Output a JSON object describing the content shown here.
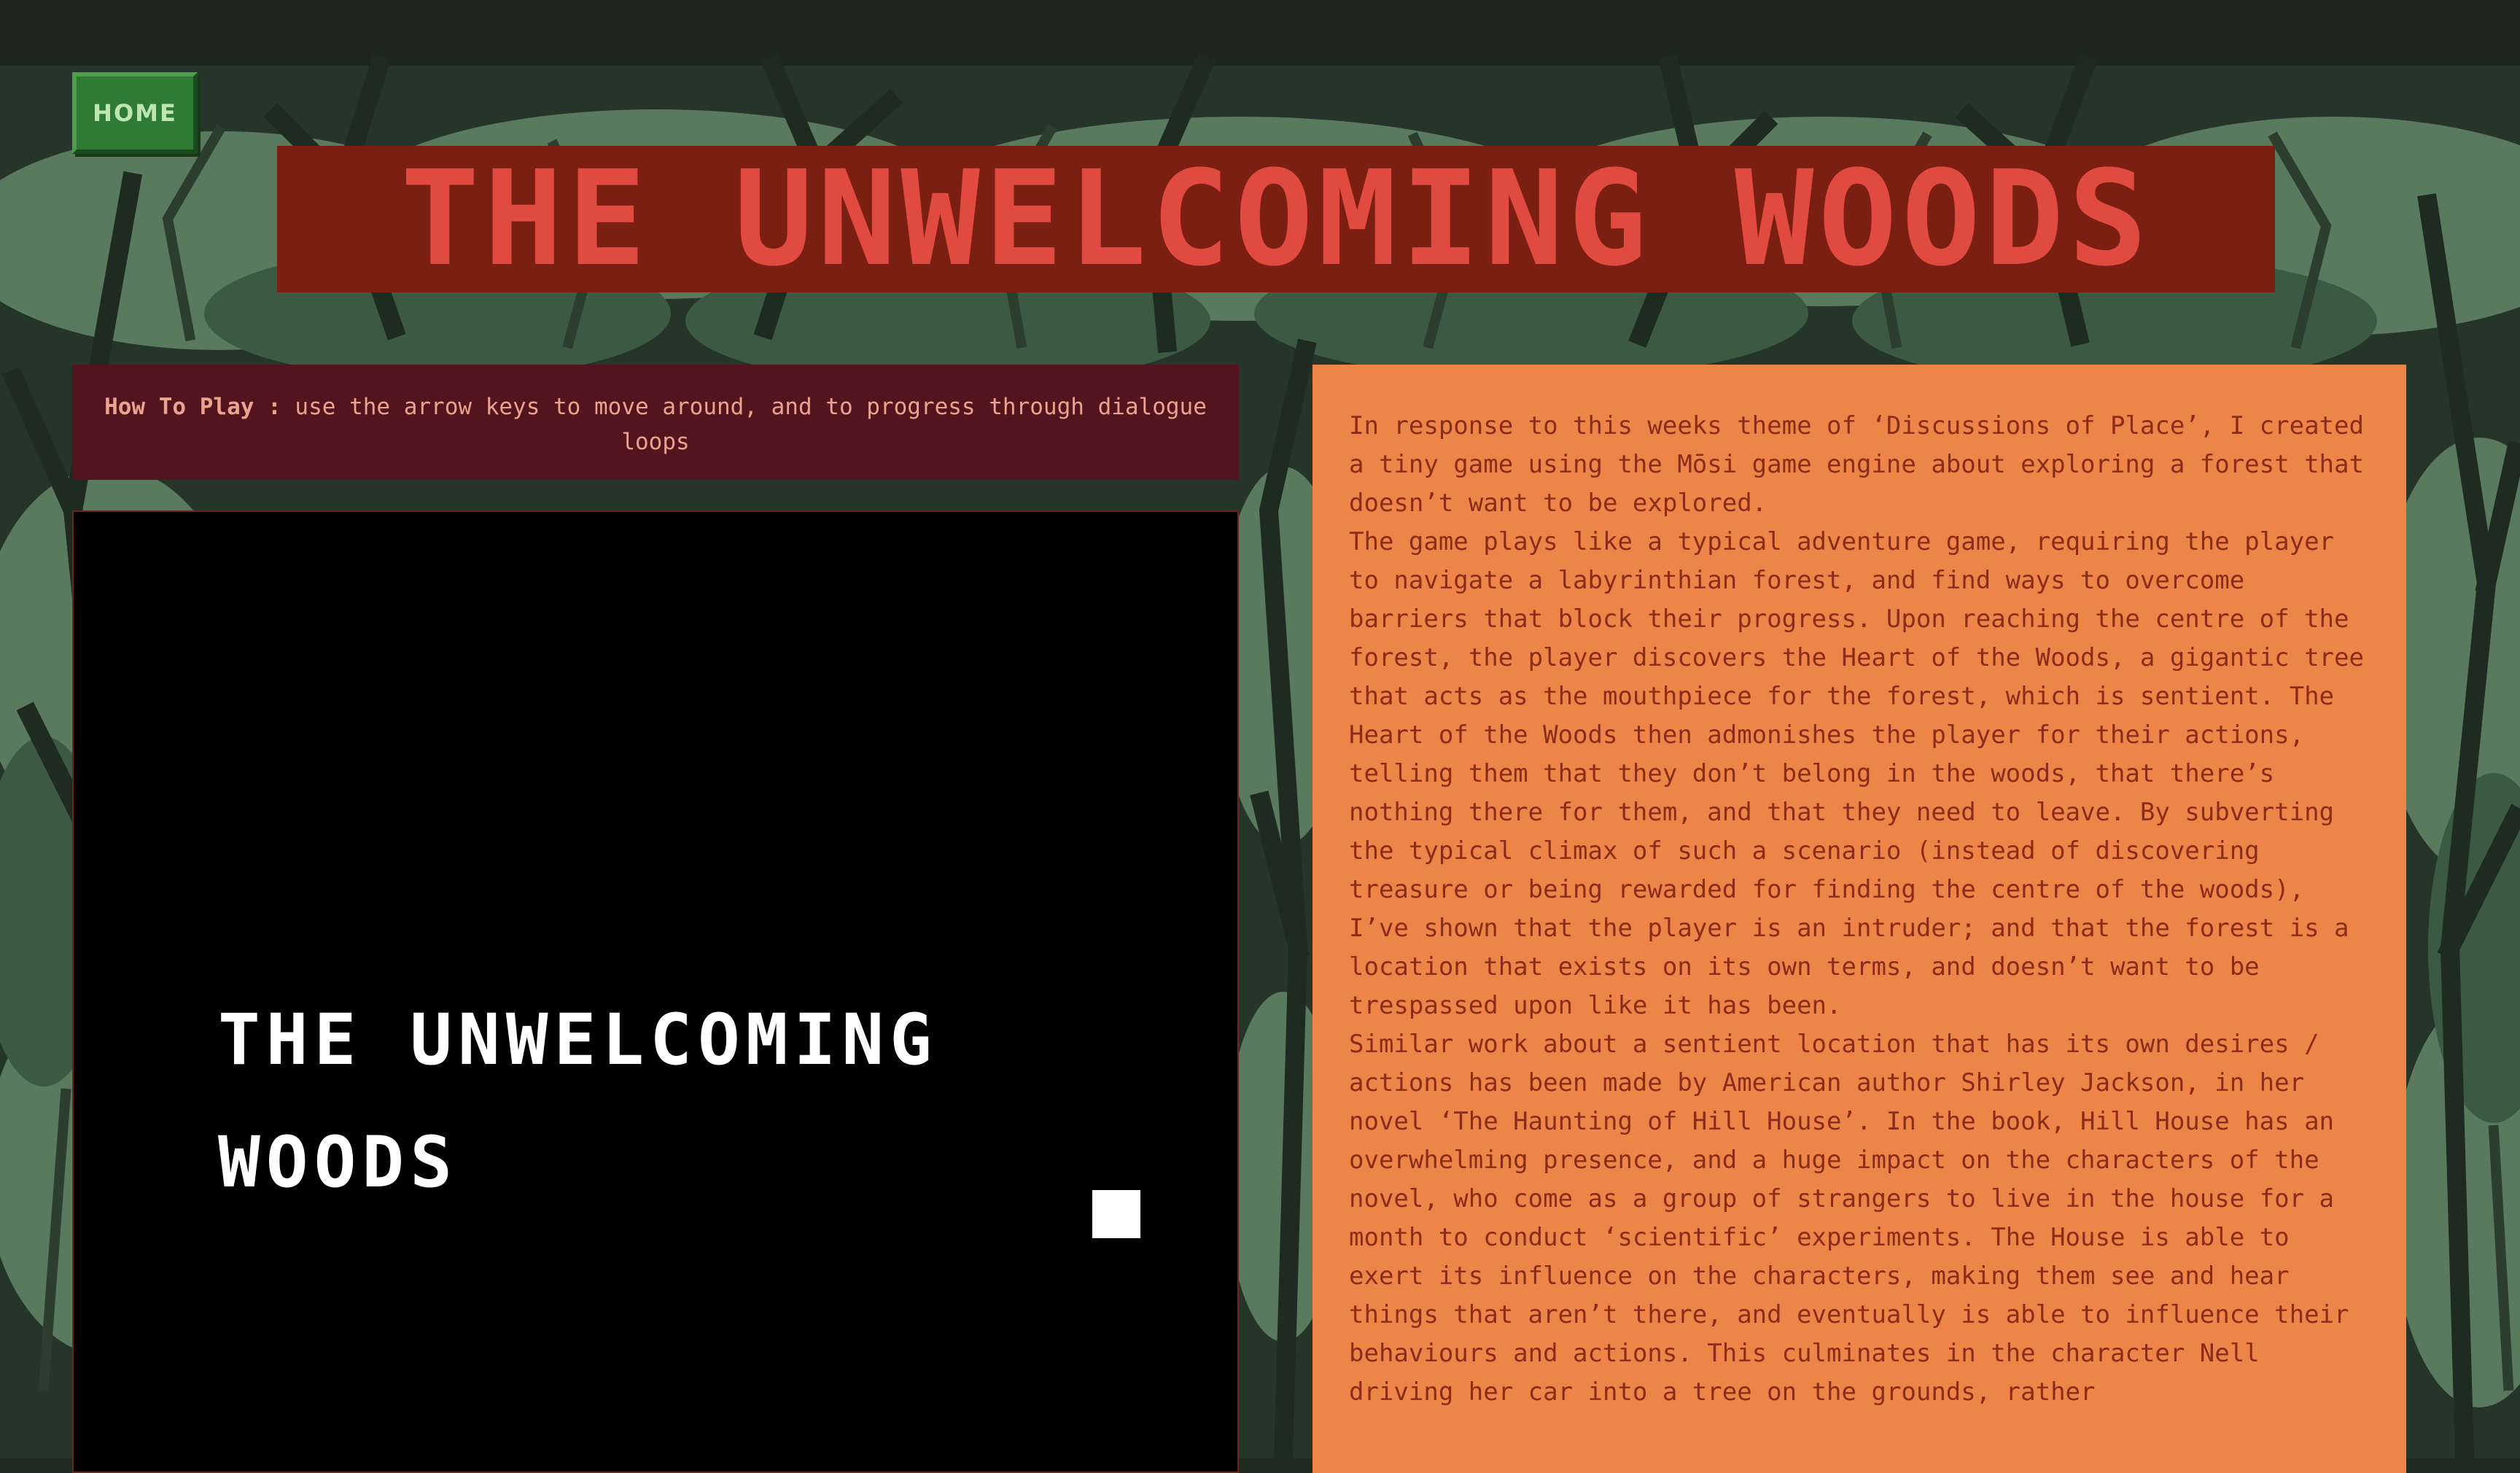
{
  "header": {
    "home_label": "HOME",
    "title": "THE UNWELCOMING WOODS"
  },
  "how_to_play": {
    "label": "How To Play :",
    "text": " use the arrow keys to move around, and to progress through dialogue loops"
  },
  "game": {
    "title_line1": "THE UNWELCOMING",
    "title_line2": "WOODS"
  },
  "description": {
    "paragraphs": [
      "In response to this weeks theme of ‘Discussions of Place’, I created a tiny game using the Mōsi game engine about exploring a forest that doesn’t want to be explored.",
      "The game plays like a typical adventure game, requiring the player to navigate a labyrinthian forest, and find ways to overcome barriers that block their progress. Upon reaching the centre of the forest, the player discovers the Heart of the Woods, a gigantic tree that acts as the mouthpiece for the forest, which is sentient. The Heart of the Woods then admonishes the player for their actions, telling them that they don’t belong in the woods, that there’s nothing there for them, and that they need to leave. By subverting the typical climax of such a scenario (instead of discovering treasure or being rewarded for finding the centre of the woods), I’ve shown that the player is an intruder; and that the forest is a location that exists on its own terms, and doesn’t want to be trespassed upon like it has been.",
      "Similar work about a sentient location that has its own desires / actions has been made by American author Shirley Jackson, in her novel ‘The Haunting of Hill House’. In the book, Hill House has an overwhelming presence, and a huge impact on the characters of the novel, who come as a group of strangers to live in the house for a month to conduct ‘scientific’ experiments. The House is able to exert its influence on the characters, making them see and hear things that aren’t there, and eventually is able to influence their behaviours and actions. This culminates in the character Nell driving her car into a tree on the grounds, rather"
    ]
  },
  "colors": {
    "forest_dark": "#1f2a21",
    "forest_mid": "#3c5a41",
    "forest_light": "#5a7a5e",
    "title_banner_bg": "#7a1f12",
    "title_text": "#e04a40",
    "how_to_play_bg": "#52141d",
    "how_to_play_text": "#eba38f",
    "description_bg": "#ee8548",
    "description_text": "#8a2c1a",
    "home_button_bg": "#2f7a35",
    "home_button_text": "#bde6b3"
  }
}
